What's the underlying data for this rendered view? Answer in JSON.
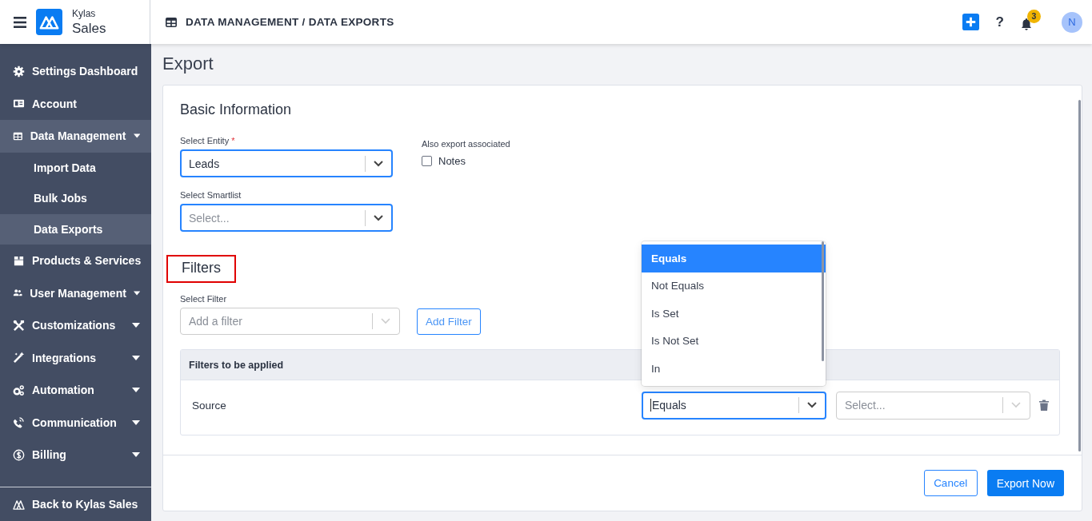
{
  "header": {
    "brand_top": "Kylas",
    "brand_name": "Sales",
    "breadcrumb": "DATA MANAGEMENT / DATA EXPORTS",
    "help": "?",
    "notification_count": "3",
    "avatar_initial": "N"
  },
  "sidebar": {
    "items": [
      {
        "label": "Settings Dashboard",
        "selected": false,
        "expandable": false
      },
      {
        "label": "Account",
        "selected": false,
        "expandable": false
      },
      {
        "label": "Data Management",
        "selected": true,
        "expandable": true,
        "children": [
          {
            "label": "Import Data",
            "selected": false
          },
          {
            "label": "Bulk Jobs",
            "selected": false
          },
          {
            "label": "Data Exports",
            "selected": true
          }
        ]
      },
      {
        "label": "Products & Services",
        "selected": false,
        "expandable": false
      },
      {
        "label": "User Management",
        "selected": false,
        "expandable": true
      },
      {
        "label": "Customizations",
        "selected": false,
        "expandable": true
      },
      {
        "label": "Integrations",
        "selected": false,
        "expandable": true
      },
      {
        "label": "Automation",
        "selected": false,
        "expandable": true
      },
      {
        "label": "Communication",
        "selected": false,
        "expandable": true
      },
      {
        "label": "Billing",
        "selected": false,
        "expandable": true
      }
    ],
    "footer_link": "Back to Kylas Sales"
  },
  "page_title": "Export",
  "basic_information": {
    "heading": "Basic Information",
    "entity": {
      "label": "Select Entity",
      "required_mark": "*",
      "value": "Leads",
      "focused": true
    },
    "associated": {
      "label": "Also export associated",
      "options": [
        {
          "label": "Notes",
          "checked": false
        }
      ]
    },
    "smartlist": {
      "label": "Select Smartlist",
      "placeholder": "Select...",
      "focused": true
    }
  },
  "filters": {
    "heading": "Filters",
    "highlighted": true,
    "select": {
      "label": "Select Filter",
      "placeholder": "Add a filter",
      "focused": false
    },
    "add_button": "Add Filter",
    "table": {
      "header": "Filters to be applied",
      "rows": [
        {
          "field": "Source",
          "operator": "Equals",
          "operator_focused": true,
          "value_placeholder": "Select..."
        }
      ]
    },
    "operator_menu": [
      {
        "label": "Equals",
        "selected": true
      },
      {
        "label": "Not Equals",
        "selected": false
      },
      {
        "label": "Is Set",
        "selected": false
      },
      {
        "label": "Is Not Set",
        "selected": false
      },
      {
        "label": "In",
        "selected": false
      }
    ]
  },
  "footer": {
    "cancel": "Cancel",
    "submit": "Export Now"
  }
}
